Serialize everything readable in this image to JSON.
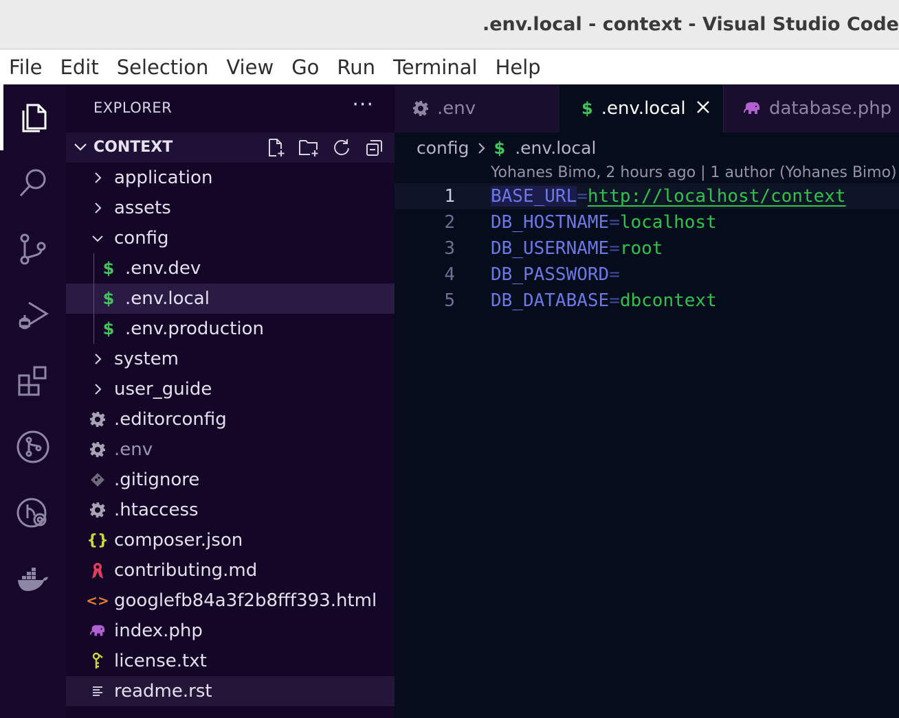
{
  "window": {
    "title": ".env.local - context - Visual Studio Code"
  },
  "menu": [
    "File",
    "Edit",
    "Selection",
    "View",
    "Go",
    "Run",
    "Terminal",
    "Help"
  ],
  "activity_bar": [
    "explorer-icon",
    "search-icon",
    "source-control-icon",
    "run-debug-icon",
    "extensions-icon",
    "git-graph-icon",
    "remote-icon",
    "docker-icon"
  ],
  "sidebar": {
    "title": "EXPLORER",
    "more": "···",
    "section": "CONTEXT",
    "items": [
      {
        "label": "application",
        "type": "folder",
        "icon": "chevron-right-icon"
      },
      {
        "label": "assets",
        "type": "folder",
        "icon": "chevron-right-icon"
      },
      {
        "label": "config",
        "type": "folder-open",
        "icon": "chevron-down-icon"
      },
      {
        "label": ".env.dev",
        "type": "env",
        "icon": "$"
      },
      {
        "label": ".env.local",
        "type": "env",
        "icon": "$"
      },
      {
        "label": ".env.production",
        "type": "env",
        "icon": "$"
      },
      {
        "label": "system",
        "type": "folder",
        "icon": "chevron-right-icon"
      },
      {
        "label": "user_guide",
        "type": "folder",
        "icon": "chevron-right-icon"
      },
      {
        "label": ".editorconfig",
        "type": "settings",
        "icon": "gear-icon"
      },
      {
        "label": ".env",
        "type": "settings",
        "icon": "gear-icon"
      },
      {
        "label": ".gitignore",
        "type": "git",
        "icon": "git-icon"
      },
      {
        "label": ".htaccess",
        "type": "settings",
        "icon": "gear-icon"
      },
      {
        "label": "composer.json",
        "type": "json",
        "icon": "{}"
      },
      {
        "label": "contributing.md",
        "type": "md",
        "icon": "ribbon-icon"
      },
      {
        "label": "googlefb84a3f2b8fff393.html",
        "type": "html",
        "icon": "<>"
      },
      {
        "label": "index.php",
        "type": "php",
        "icon": "elephant-icon"
      },
      {
        "label": "license.txt",
        "type": "license",
        "icon": "key-icon"
      },
      {
        "label": "readme.rst",
        "type": "rst",
        "icon": "lines-icon"
      }
    ]
  },
  "tabs": [
    {
      "label": ".env",
      "icon": "gear-icon",
      "active": false
    },
    {
      "label": ".env.local",
      "icon": "$",
      "active": true
    },
    {
      "label": "database.php",
      "icon": "elephant-icon",
      "active": false
    }
  ],
  "breadcrumb": {
    "folder": "config",
    "icon": "$",
    "file": ".env.local"
  },
  "codelens": "Yohanes Bimo, 2 hours ago | 1 author (Yohanes Bimo)",
  "code": [
    {
      "num": "1",
      "key": "BASE_URL",
      "eq": "=",
      "value": "http://localhost/context"
    },
    {
      "num": "2",
      "key": "DB_HOSTNAME",
      "eq": "=",
      "value": "localhost"
    },
    {
      "num": "3",
      "key": "DB_USERNAME",
      "eq": "=",
      "value": "root"
    },
    {
      "num": "4",
      "key": "DB_PASSWORD",
      "eq": "=",
      "value": ""
    },
    {
      "num": "5",
      "key": "DB_DATABASE",
      "eq": "=",
      "value": "dbcontext"
    }
  ],
  "colors": {
    "activity_bar": "#17082b",
    "sidebar": "#140627",
    "editor": "#050c1c",
    "key": "#6c78e6",
    "value": "#31c24b",
    "env_icon": "#45c25b"
  }
}
